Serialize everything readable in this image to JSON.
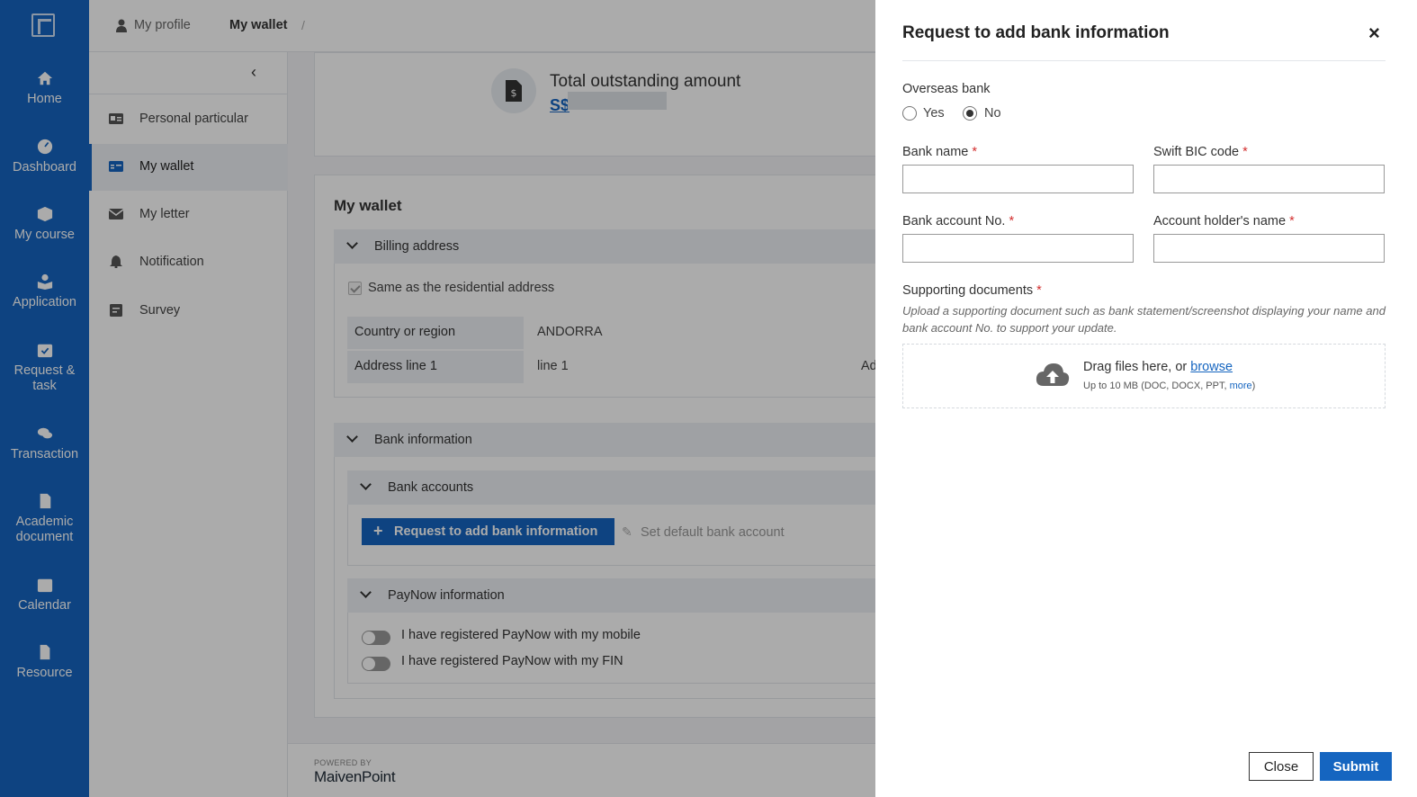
{
  "nav": {
    "items": [
      {
        "label_1": "Home",
        "label_2": "",
        "icon": "home-icon"
      },
      {
        "label_1": "Dashboard",
        "label_2": "",
        "icon": "dashboard-icon"
      },
      {
        "label_1": "My course",
        "label_2": "",
        "icon": "course-icon"
      },
      {
        "label_1": "Application",
        "label_2": "",
        "icon": "application-icon"
      },
      {
        "label_1": "Request &",
        "label_2": "task",
        "icon": "calendar-check-icon"
      },
      {
        "label_1": "Transaction",
        "label_2": "",
        "icon": "coins-icon"
      },
      {
        "label_1": "Academic",
        "label_2": "document",
        "icon": "pdf-icon"
      },
      {
        "label_1": "Calendar",
        "label_2": "",
        "icon": "calendar-icon"
      },
      {
        "label_1": "Resource",
        "label_2": "",
        "icon": "file-icon"
      }
    ]
  },
  "breadcrumb": {
    "parent": "My profile",
    "separator": "/",
    "current": "My wallet"
  },
  "subnav": {
    "items": [
      {
        "label": "Personal particular"
      },
      {
        "label": "My wallet"
      },
      {
        "label": "My letter"
      },
      {
        "label": "Notification"
      },
      {
        "label": "Survey"
      }
    ]
  },
  "outstanding": {
    "title": "Total outstanding amount",
    "amount": "S$"
  },
  "wallet": {
    "title": "My wallet",
    "billing": {
      "header": "Billing address",
      "same_as_label": "Same as the residential address",
      "rows": [
        {
          "key": "Country or region",
          "value": "ANDORRA"
        },
        {
          "key": "Address line 1",
          "value": "line 1",
          "extra": "Ad"
        }
      ]
    },
    "bank": {
      "header": "Bank information",
      "accounts_header": "Bank accounts",
      "add_button": "Request to add bank information",
      "default_button": "Set default bank account",
      "paynow_header": "PayNow information",
      "paynow_mobile": "I have registered PayNow with my mobile",
      "paynow_fin": "I have registered PayNow with my FIN"
    }
  },
  "footer": {
    "powered_by": "POWERED BY",
    "brand": "MaivenPoint"
  },
  "drawer": {
    "title": "Request to add bank information",
    "overseas_label": "Overseas bank",
    "radio_yes": "Yes",
    "radio_no": "No",
    "overseas_selected": "No",
    "bank_name_label": "Bank name",
    "swift_label": "Swift BIC code",
    "account_no_label": "Bank account No.",
    "holder_label": "Account holder's name",
    "required_mark": "*",
    "docs_label": "Supporting documents",
    "docs_hint": "Upload a supporting document such as bank statement/screenshot displaying your name and bank account No. to support your update.",
    "drop_text": "Drag files here, or ",
    "browse": "browse",
    "drop_sub": "Up to 10 MB (DOC, DOCX, PPT, ",
    "drop_more": "more",
    "drop_sub_end": ")",
    "close_button": "Close",
    "submit_button": "Submit",
    "inputs": {
      "bank_name": "",
      "swift": "",
      "account_no": "",
      "holder": ""
    }
  },
  "colors": {
    "primary": "#1565c0",
    "required": "#d32f2f"
  }
}
